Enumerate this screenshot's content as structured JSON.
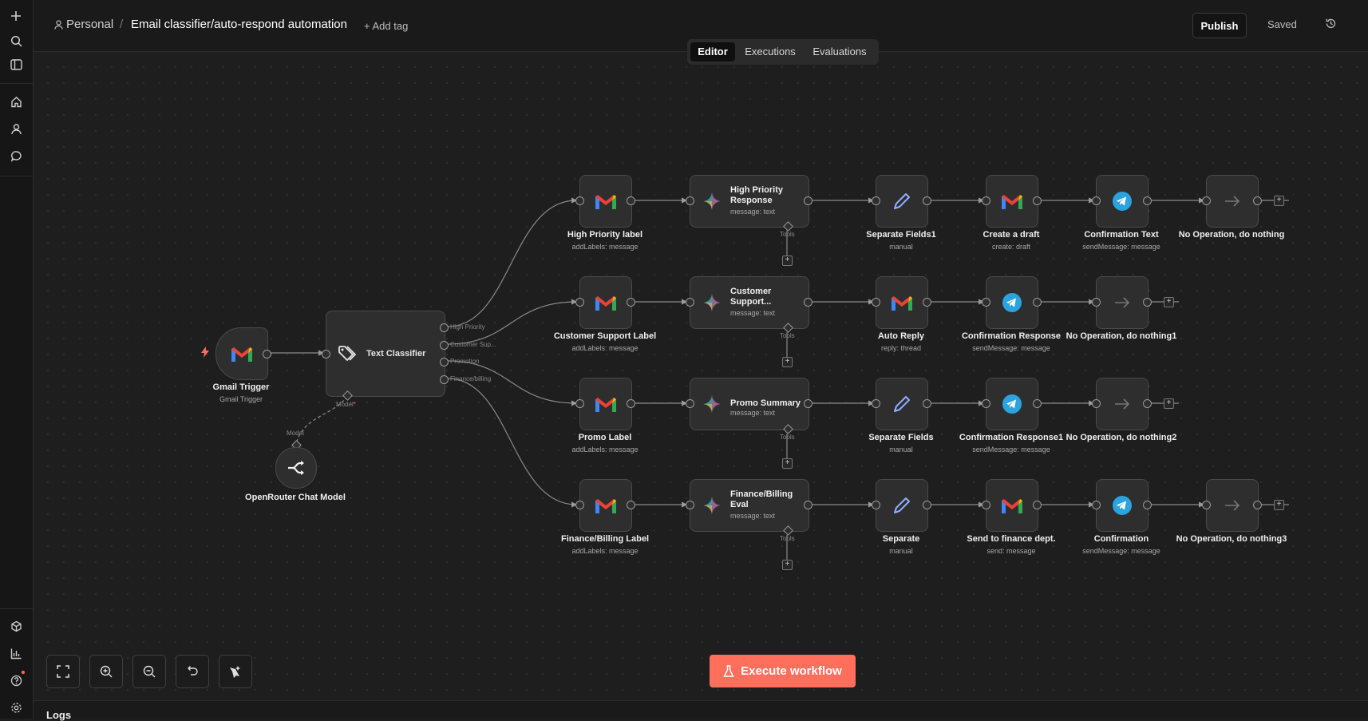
{
  "breadcrumb": {
    "workspace": "Personal",
    "separator": "/",
    "workflow_name": "Email classifier/auto-respond automation",
    "add_tag": "+ Add tag"
  },
  "header": {
    "publish": "Publish",
    "saved": "Saved"
  },
  "tabs": [
    "Editor",
    "Executions",
    "Evaluations"
  ],
  "nodes": {
    "gmail_trigger": {
      "title": "Gmail Trigger",
      "subtitle": "Gmail Trigger"
    },
    "text_classifier": {
      "title": "Text Classifier",
      "outputs": [
        "High Priority",
        "Customer Sup...",
        "Promotion",
        "Finance/billing"
      ],
      "model_port": "Model",
      "required_mark": "*"
    },
    "openrouter": {
      "title": "OpenRouter Chat Model",
      "port_label": "Model"
    },
    "row1": [
      {
        "title": "High Priority label",
        "subtitle": "addLabels: message"
      },
      {
        "title": "High Priority Response",
        "subtitle": "message: text",
        "tools": "Tools"
      },
      {
        "title": "Separate Fields1",
        "subtitle": "manual"
      },
      {
        "title": "Create a draft",
        "subtitle": "create: draft"
      },
      {
        "title": "Confirmation Text",
        "subtitle": "sendMessage: message"
      },
      {
        "title": "No Operation, do nothing",
        "subtitle": ""
      }
    ],
    "row2": [
      {
        "title": "Customer Support Label",
        "subtitle": "addLabels: message"
      },
      {
        "title": "Customer Support...",
        "subtitle": "message: text",
        "tools": "Tools"
      },
      {
        "title": "Auto Reply",
        "subtitle": "reply: thread"
      },
      {
        "title": "Confirmation Response",
        "subtitle": "sendMessage: message"
      },
      {
        "title": "No Operation, do nothing1",
        "subtitle": ""
      }
    ],
    "row3": [
      {
        "title": "Promo Label",
        "subtitle": "addLabels: message"
      },
      {
        "title": "Promo Summary",
        "subtitle": "message: text",
        "tools": "Tools"
      },
      {
        "title": "Separate Fields",
        "subtitle": "manual"
      },
      {
        "title": "Confirmation Response1",
        "subtitle": "sendMessage: message"
      },
      {
        "title": "No Operation, do nothing2",
        "subtitle": ""
      }
    ],
    "row4": [
      {
        "title": "Finance/Billing Label",
        "subtitle": "addLabels: message"
      },
      {
        "title": "Finance/Billing Eval",
        "subtitle": "message: text",
        "tools": "Tools"
      },
      {
        "title": "Separate",
        "subtitle": "manual"
      },
      {
        "title": "Send to finance dept.",
        "subtitle": "send: message"
      },
      {
        "title": "Confirmation",
        "subtitle": "sendMessage: message"
      },
      {
        "title": "No Operation, do nothing3",
        "subtitle": ""
      }
    ]
  },
  "execute_button": "Execute workflow",
  "logs_label": "Logs",
  "icons": [
    "plus-icon",
    "search-icon",
    "panel-icon",
    "home-icon",
    "user-icon",
    "chat-icon",
    "templates-icon",
    "insights-icon",
    "help-icon",
    "settings-icon",
    "history-icon",
    "fit-view-icon",
    "zoom-in-icon",
    "zoom-out-icon",
    "reset-zoom-icon",
    "tidy-up-icon",
    "flask-icon",
    "gmail-icon",
    "gemini-icon",
    "pencil-icon",
    "telegram-icon",
    "arrow-right-icon",
    "tag-icon",
    "openrouter-icon",
    "bolt-icon"
  ],
  "colors": {
    "accent": "#ff6f5c",
    "canvas": "#1e1e1e",
    "node": "#2e2e2e",
    "telegram": "#2aa3df",
    "edit_blue": "#8fb0ff"
  }
}
